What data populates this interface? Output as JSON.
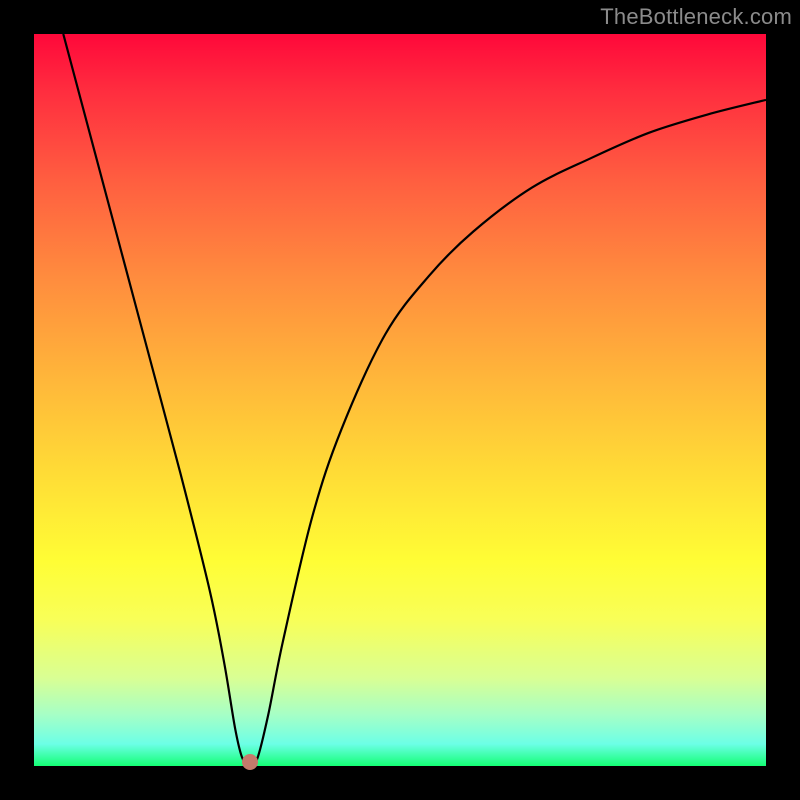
{
  "watermark": "TheBottleneck.com",
  "chart_data": {
    "type": "line",
    "title": "",
    "xlabel": "",
    "ylabel": "",
    "xlim": [
      0,
      100
    ],
    "ylim": [
      0,
      100
    ],
    "series": [
      {
        "name": "curve",
        "x": [
          4,
          8,
          12,
          16,
          20,
          24,
          26,
          27.5,
          28.5,
          29.5,
          30.5,
          32,
          34,
          38,
          42,
          48,
          54,
          60,
          68,
          76,
          84,
          92,
          100
        ],
        "y": [
          100,
          85,
          70,
          55,
          40,
          24,
          14,
          5,
          1,
          0.5,
          1,
          7,
          17,
          34,
          46,
          59,
          67,
          73,
          79,
          83,
          86.5,
          89,
          91
        ]
      }
    ],
    "marker": {
      "x": 29.5,
      "y": 0.5
    },
    "gradient_stops": [
      {
        "pos": 0,
        "color": "#ff083a"
      },
      {
        "pos": 72,
        "color": "#fffd35"
      },
      {
        "pos": 100,
        "color": "#14ff75"
      }
    ]
  }
}
